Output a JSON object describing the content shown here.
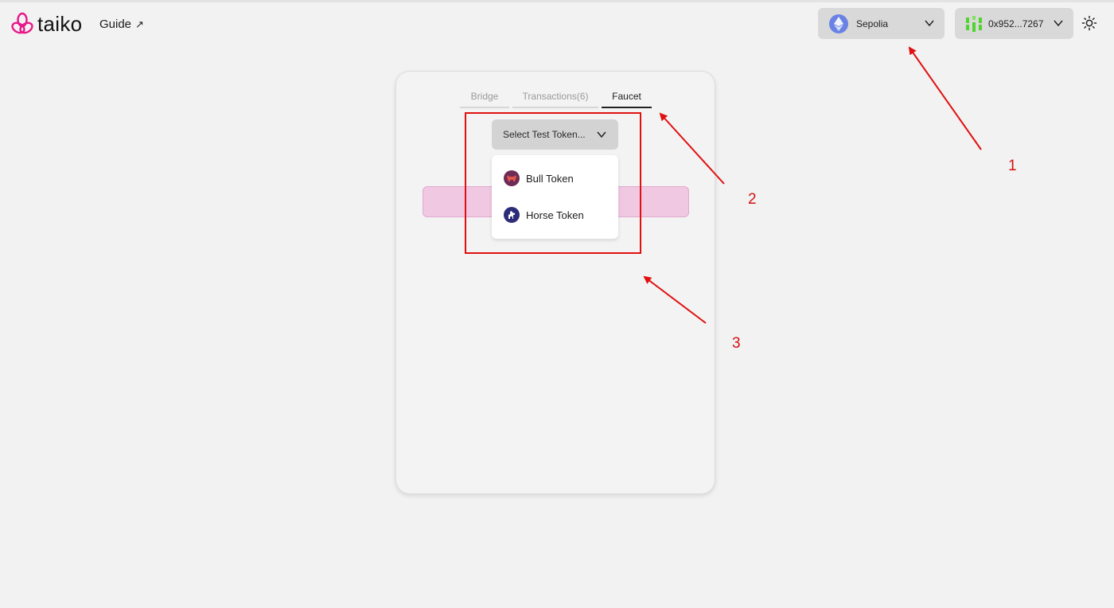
{
  "header": {
    "logo_text": "taiko",
    "guide_label": "Guide",
    "guide_arrow": "↗",
    "network": {
      "label": "Sepolia",
      "icon": "ethereum-icon"
    },
    "account": {
      "label": "0x952...7267",
      "icon": "wallet-avatar-icon"
    },
    "theme_icon": "sun-icon"
  },
  "card": {
    "tabs": [
      {
        "label": "Bridge",
        "active": false
      },
      {
        "label": "Transactions(6)",
        "active": false
      },
      {
        "label": "Faucet",
        "active": true
      }
    ],
    "select": {
      "label": "Select Test Token..."
    },
    "menu": [
      {
        "label": "Bull Token",
        "icon": "bull-token-icon"
      },
      {
        "label": "Horse Token",
        "icon": "horse-token-icon"
      }
    ]
  },
  "annotations": {
    "labels": [
      "1",
      "2",
      "3"
    ],
    "color": "#d41010"
  }
}
